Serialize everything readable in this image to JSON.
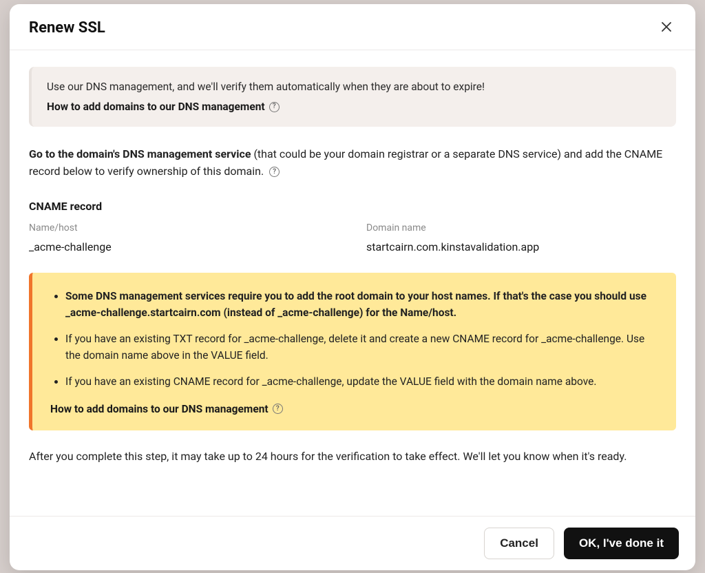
{
  "modal": {
    "title": "Renew SSL",
    "info": {
      "line1": "Use our DNS management, and we'll verify them automatically when they are about to expire!",
      "link": "How to add domains to our DNS management"
    },
    "instruction": {
      "bold": "Go to the domain's DNS management service",
      "rest": " (that could be your domain registrar or a separate DNS service) and add the CNAME record below to verify ownership of this domain."
    },
    "cname": {
      "section_label": "CNAME record",
      "name_head": "Name/host",
      "name_val": "_acme-challenge",
      "domain_head": "Domain name",
      "domain_val": "startcairn.com.kinstavalidation.app"
    },
    "warn": {
      "bullet1": "Some DNS management services require you to add the root domain to your host names. If that's the case you should use _acme-challenge.startcairn.com (instead of _acme-challenge) for the Name/host.",
      "bullet2": "If you have an existing TXT record for _acme-challenge, delete it and create a new CNAME record for _acme-challenge. Use the domain name above in the VALUE field.",
      "bullet3": "If you have an existing CNAME record for _acme-challenge, update the VALUE field with the domain name above.",
      "link": "How to add domains to our DNS management"
    },
    "after_note": "After you complete this step, it may take up to 24 hours for the verification to take effect. We'll let you know when it's ready.",
    "footer": {
      "cancel": "Cancel",
      "ok": "OK, I've done it"
    }
  }
}
